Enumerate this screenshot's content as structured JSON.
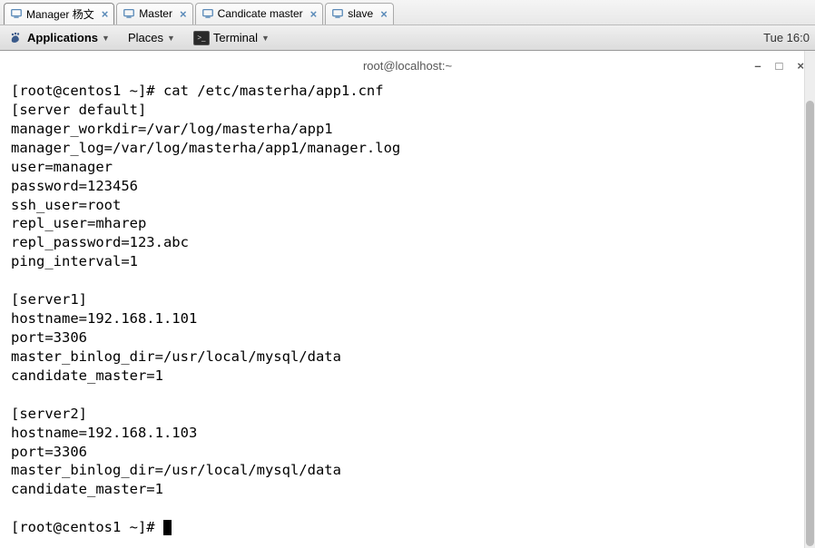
{
  "tabs": [
    {
      "label": "Manager 杨文",
      "active": true
    },
    {
      "label": "Master",
      "active": false
    },
    {
      "label": "Candicate master",
      "active": false
    },
    {
      "label": "slave",
      "active": false
    }
  ],
  "menubar": {
    "applications": "Applications",
    "places": "Places",
    "terminal": "Terminal",
    "clock": "Tue 16:0"
  },
  "terminal": {
    "title": "root@localhost:~",
    "prompt1": "[root@centos1 ~]# ",
    "command1": "cat /etc/masterha/app1.cnf",
    "lines": [
      "[server default]",
      "manager_workdir=/var/log/masterha/app1",
      "manager_log=/var/log/masterha/app1/manager.log",
      "user=manager",
      "password=123456",
      "ssh_user=root",
      "repl_user=mharep",
      "repl_password=123.abc",
      "ping_interval=1",
      "",
      "[server1]",
      "hostname=192.168.1.101",
      "port=3306",
      "master_binlog_dir=/usr/local/mysql/data",
      "candidate_master=1",
      "",
      "[server2]",
      "hostname=192.168.1.103",
      "port=3306",
      "master_binlog_dir=/usr/local/mysql/data",
      "candidate_master=1",
      ""
    ],
    "prompt2": "[root@centos1 ~]# "
  },
  "window_controls": {
    "minimize": "–",
    "maximize": "□",
    "close": "×"
  }
}
